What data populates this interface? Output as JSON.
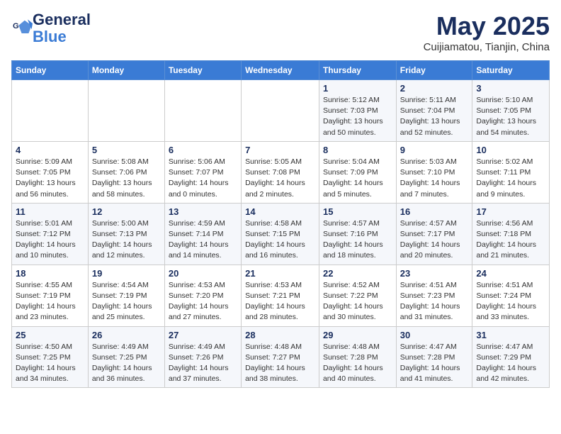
{
  "header": {
    "logo_line1": "General",
    "logo_line2": "Blue",
    "month": "May 2025",
    "location": "Cuijiamatou, Tianjin, China"
  },
  "weekdays": [
    "Sunday",
    "Monday",
    "Tuesday",
    "Wednesday",
    "Thursday",
    "Friday",
    "Saturday"
  ],
  "weeks": [
    [
      {
        "day": "",
        "info": ""
      },
      {
        "day": "",
        "info": ""
      },
      {
        "day": "",
        "info": ""
      },
      {
        "day": "",
        "info": ""
      },
      {
        "day": "1",
        "info": "Sunrise: 5:12 AM\nSunset: 7:03 PM\nDaylight: 13 hours\nand 50 minutes."
      },
      {
        "day": "2",
        "info": "Sunrise: 5:11 AM\nSunset: 7:04 PM\nDaylight: 13 hours\nand 52 minutes."
      },
      {
        "day": "3",
        "info": "Sunrise: 5:10 AM\nSunset: 7:05 PM\nDaylight: 13 hours\nand 54 minutes."
      }
    ],
    [
      {
        "day": "4",
        "info": "Sunrise: 5:09 AM\nSunset: 7:05 PM\nDaylight: 13 hours\nand 56 minutes."
      },
      {
        "day": "5",
        "info": "Sunrise: 5:08 AM\nSunset: 7:06 PM\nDaylight: 13 hours\nand 58 minutes."
      },
      {
        "day": "6",
        "info": "Sunrise: 5:06 AM\nSunset: 7:07 PM\nDaylight: 14 hours\nand 0 minutes."
      },
      {
        "day": "7",
        "info": "Sunrise: 5:05 AM\nSunset: 7:08 PM\nDaylight: 14 hours\nand 2 minutes."
      },
      {
        "day": "8",
        "info": "Sunrise: 5:04 AM\nSunset: 7:09 PM\nDaylight: 14 hours\nand 5 minutes."
      },
      {
        "day": "9",
        "info": "Sunrise: 5:03 AM\nSunset: 7:10 PM\nDaylight: 14 hours\nand 7 minutes."
      },
      {
        "day": "10",
        "info": "Sunrise: 5:02 AM\nSunset: 7:11 PM\nDaylight: 14 hours\nand 9 minutes."
      }
    ],
    [
      {
        "day": "11",
        "info": "Sunrise: 5:01 AM\nSunset: 7:12 PM\nDaylight: 14 hours\nand 10 minutes."
      },
      {
        "day": "12",
        "info": "Sunrise: 5:00 AM\nSunset: 7:13 PM\nDaylight: 14 hours\nand 12 minutes."
      },
      {
        "day": "13",
        "info": "Sunrise: 4:59 AM\nSunset: 7:14 PM\nDaylight: 14 hours\nand 14 minutes."
      },
      {
        "day": "14",
        "info": "Sunrise: 4:58 AM\nSunset: 7:15 PM\nDaylight: 14 hours\nand 16 minutes."
      },
      {
        "day": "15",
        "info": "Sunrise: 4:57 AM\nSunset: 7:16 PM\nDaylight: 14 hours\nand 18 minutes."
      },
      {
        "day": "16",
        "info": "Sunrise: 4:57 AM\nSunset: 7:17 PM\nDaylight: 14 hours\nand 20 minutes."
      },
      {
        "day": "17",
        "info": "Sunrise: 4:56 AM\nSunset: 7:18 PM\nDaylight: 14 hours\nand 21 minutes."
      }
    ],
    [
      {
        "day": "18",
        "info": "Sunrise: 4:55 AM\nSunset: 7:19 PM\nDaylight: 14 hours\nand 23 minutes."
      },
      {
        "day": "19",
        "info": "Sunrise: 4:54 AM\nSunset: 7:19 PM\nDaylight: 14 hours\nand 25 minutes."
      },
      {
        "day": "20",
        "info": "Sunrise: 4:53 AM\nSunset: 7:20 PM\nDaylight: 14 hours\nand 27 minutes."
      },
      {
        "day": "21",
        "info": "Sunrise: 4:53 AM\nSunset: 7:21 PM\nDaylight: 14 hours\nand 28 minutes."
      },
      {
        "day": "22",
        "info": "Sunrise: 4:52 AM\nSunset: 7:22 PM\nDaylight: 14 hours\nand 30 minutes."
      },
      {
        "day": "23",
        "info": "Sunrise: 4:51 AM\nSunset: 7:23 PM\nDaylight: 14 hours\nand 31 minutes."
      },
      {
        "day": "24",
        "info": "Sunrise: 4:51 AM\nSunset: 7:24 PM\nDaylight: 14 hours\nand 33 minutes."
      }
    ],
    [
      {
        "day": "25",
        "info": "Sunrise: 4:50 AM\nSunset: 7:25 PM\nDaylight: 14 hours\nand 34 minutes."
      },
      {
        "day": "26",
        "info": "Sunrise: 4:49 AM\nSunset: 7:25 PM\nDaylight: 14 hours\nand 36 minutes."
      },
      {
        "day": "27",
        "info": "Sunrise: 4:49 AM\nSunset: 7:26 PM\nDaylight: 14 hours\nand 37 minutes."
      },
      {
        "day": "28",
        "info": "Sunrise: 4:48 AM\nSunset: 7:27 PM\nDaylight: 14 hours\nand 38 minutes."
      },
      {
        "day": "29",
        "info": "Sunrise: 4:48 AM\nSunset: 7:28 PM\nDaylight: 14 hours\nand 40 minutes."
      },
      {
        "day": "30",
        "info": "Sunrise: 4:47 AM\nSunset: 7:28 PM\nDaylight: 14 hours\nand 41 minutes."
      },
      {
        "day": "31",
        "info": "Sunrise: 4:47 AM\nSunset: 7:29 PM\nDaylight: 14 hours\nand 42 minutes."
      }
    ]
  ]
}
